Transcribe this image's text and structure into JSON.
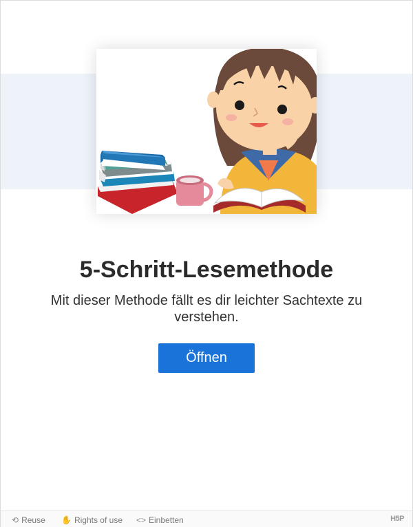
{
  "content": {
    "title": "5-Schritt-Lesemethode",
    "description": "Mit dieser Methode fällt es dir leichter Sachtexte zu verstehen.",
    "open_button": "Öffnen",
    "cover_image": "girl-reading-book-illustration"
  },
  "footer": {
    "reuse": "Reuse",
    "rights": "Rights of use",
    "embed": "Einbetten",
    "logo": "H5P"
  },
  "colors": {
    "accent": "#1a73d9",
    "band": "#eef3fa"
  }
}
